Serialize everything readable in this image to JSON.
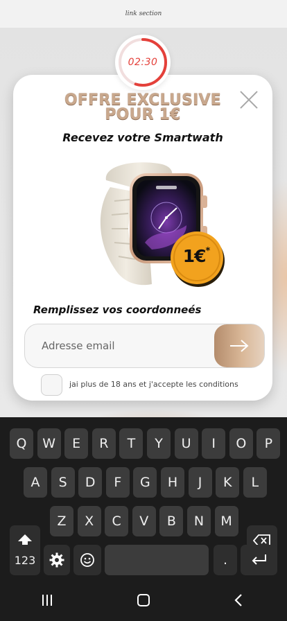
{
  "link_bar": {
    "text": "link section"
  },
  "timer": {
    "text": "02:30",
    "progress_fraction": 0.55,
    "color": "#e4403a"
  },
  "popup": {
    "headline_line1": "OFFRE EXCLUSIVE",
    "headline_line2": "POUR 1€",
    "subheadline": "Recevez votre Smartwath",
    "price_main": "1€",
    "price_asterisk": "*",
    "form_title": "Remplissez vos coordonneés",
    "email_placeholder": "Adresse email",
    "email_value": "",
    "consent_text": "jai plus de 18 ans et j'accepte les conditions",
    "accent_color": "#c9a88d",
    "coin_color": "#f2a21e",
    "icons": {
      "close": "close-icon",
      "submit": "arrow-right-icon",
      "product": "smartwatch-image"
    }
  },
  "keyboard": {
    "row1": [
      "Q",
      "W",
      "E",
      "R",
      "T",
      "Y",
      "U",
      "I",
      "O",
      "P"
    ],
    "row2": [
      "A",
      "S",
      "D",
      "F",
      "G",
      "H",
      "J",
      "K",
      "L"
    ],
    "row3": [
      "Z",
      "X",
      "C",
      "V",
      "B",
      "N",
      "M"
    ],
    "numbers_key": "123",
    "period_key": ".",
    "icons": {
      "shift": "shift-icon",
      "backspace": "backspace-icon",
      "settings": "gear-icon",
      "emoji": "emoji-icon",
      "enter": "enter-icon"
    }
  },
  "navbar": {
    "icons": {
      "recents": "recent-apps-icon",
      "home": "home-icon",
      "back": "back-icon"
    }
  }
}
